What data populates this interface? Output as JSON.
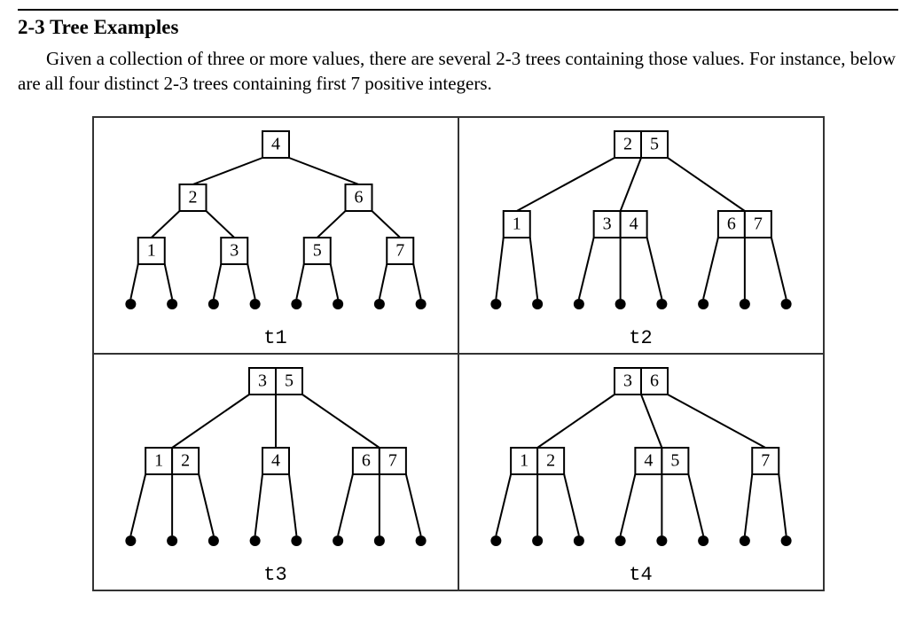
{
  "heading": "2-3 Tree Examples",
  "paragraph": "Given a collection of three or more values, there are several 2-3 trees containing those values. For instance, below are all four distinct 2-3 trees containing first 7 positive integers.",
  "trees": {
    "t1": {
      "label": "t1",
      "root": {
        "keys": [
          4
        ],
        "children": [
          {
            "keys": [
              2
            ],
            "children": [
              {
                "keys": [
                  1
                ],
                "children": [
                  "leaf",
                  "leaf"
                ]
              },
              {
                "keys": [
                  3
                ],
                "children": [
                  "leaf",
                  "leaf"
                ]
              }
            ]
          },
          {
            "keys": [
              6
            ],
            "children": [
              {
                "keys": [
                  5
                ],
                "children": [
                  "leaf",
                  "leaf"
                ]
              },
              {
                "keys": [
                  7
                ],
                "children": [
                  "leaf",
                  "leaf"
                ]
              }
            ]
          }
        ]
      }
    },
    "t2": {
      "label": "t2",
      "root": {
        "keys": [
          2,
          5
        ],
        "children": [
          {
            "keys": [
              1
            ],
            "children": [
              "leaf",
              "leaf"
            ]
          },
          {
            "keys": [
              3,
              4
            ],
            "children": [
              "leaf",
              "leaf",
              "leaf"
            ]
          },
          {
            "keys": [
              6,
              7
            ],
            "children": [
              "leaf",
              "leaf",
              "leaf"
            ]
          }
        ]
      }
    },
    "t3": {
      "label": "t3",
      "root": {
        "keys": [
          3,
          5
        ],
        "children": [
          {
            "keys": [
              1,
              2
            ],
            "children": [
              "leaf",
              "leaf",
              "leaf"
            ]
          },
          {
            "keys": [
              4
            ],
            "children": [
              "leaf",
              "leaf"
            ]
          },
          {
            "keys": [
              6,
              7
            ],
            "children": [
              "leaf",
              "leaf",
              "leaf"
            ]
          }
        ]
      }
    },
    "t4": {
      "label": "t4",
      "root": {
        "keys": [
          3,
          6
        ],
        "children": [
          {
            "keys": [
              1,
              2
            ],
            "children": [
              "leaf",
              "leaf",
              "leaf"
            ]
          },
          {
            "keys": [
              4,
              5
            ],
            "children": [
              "leaf",
              "leaf",
              "leaf"
            ]
          },
          {
            "keys": [
              7
            ],
            "children": [
              "leaf",
              "leaf"
            ]
          }
        ]
      }
    }
  }
}
